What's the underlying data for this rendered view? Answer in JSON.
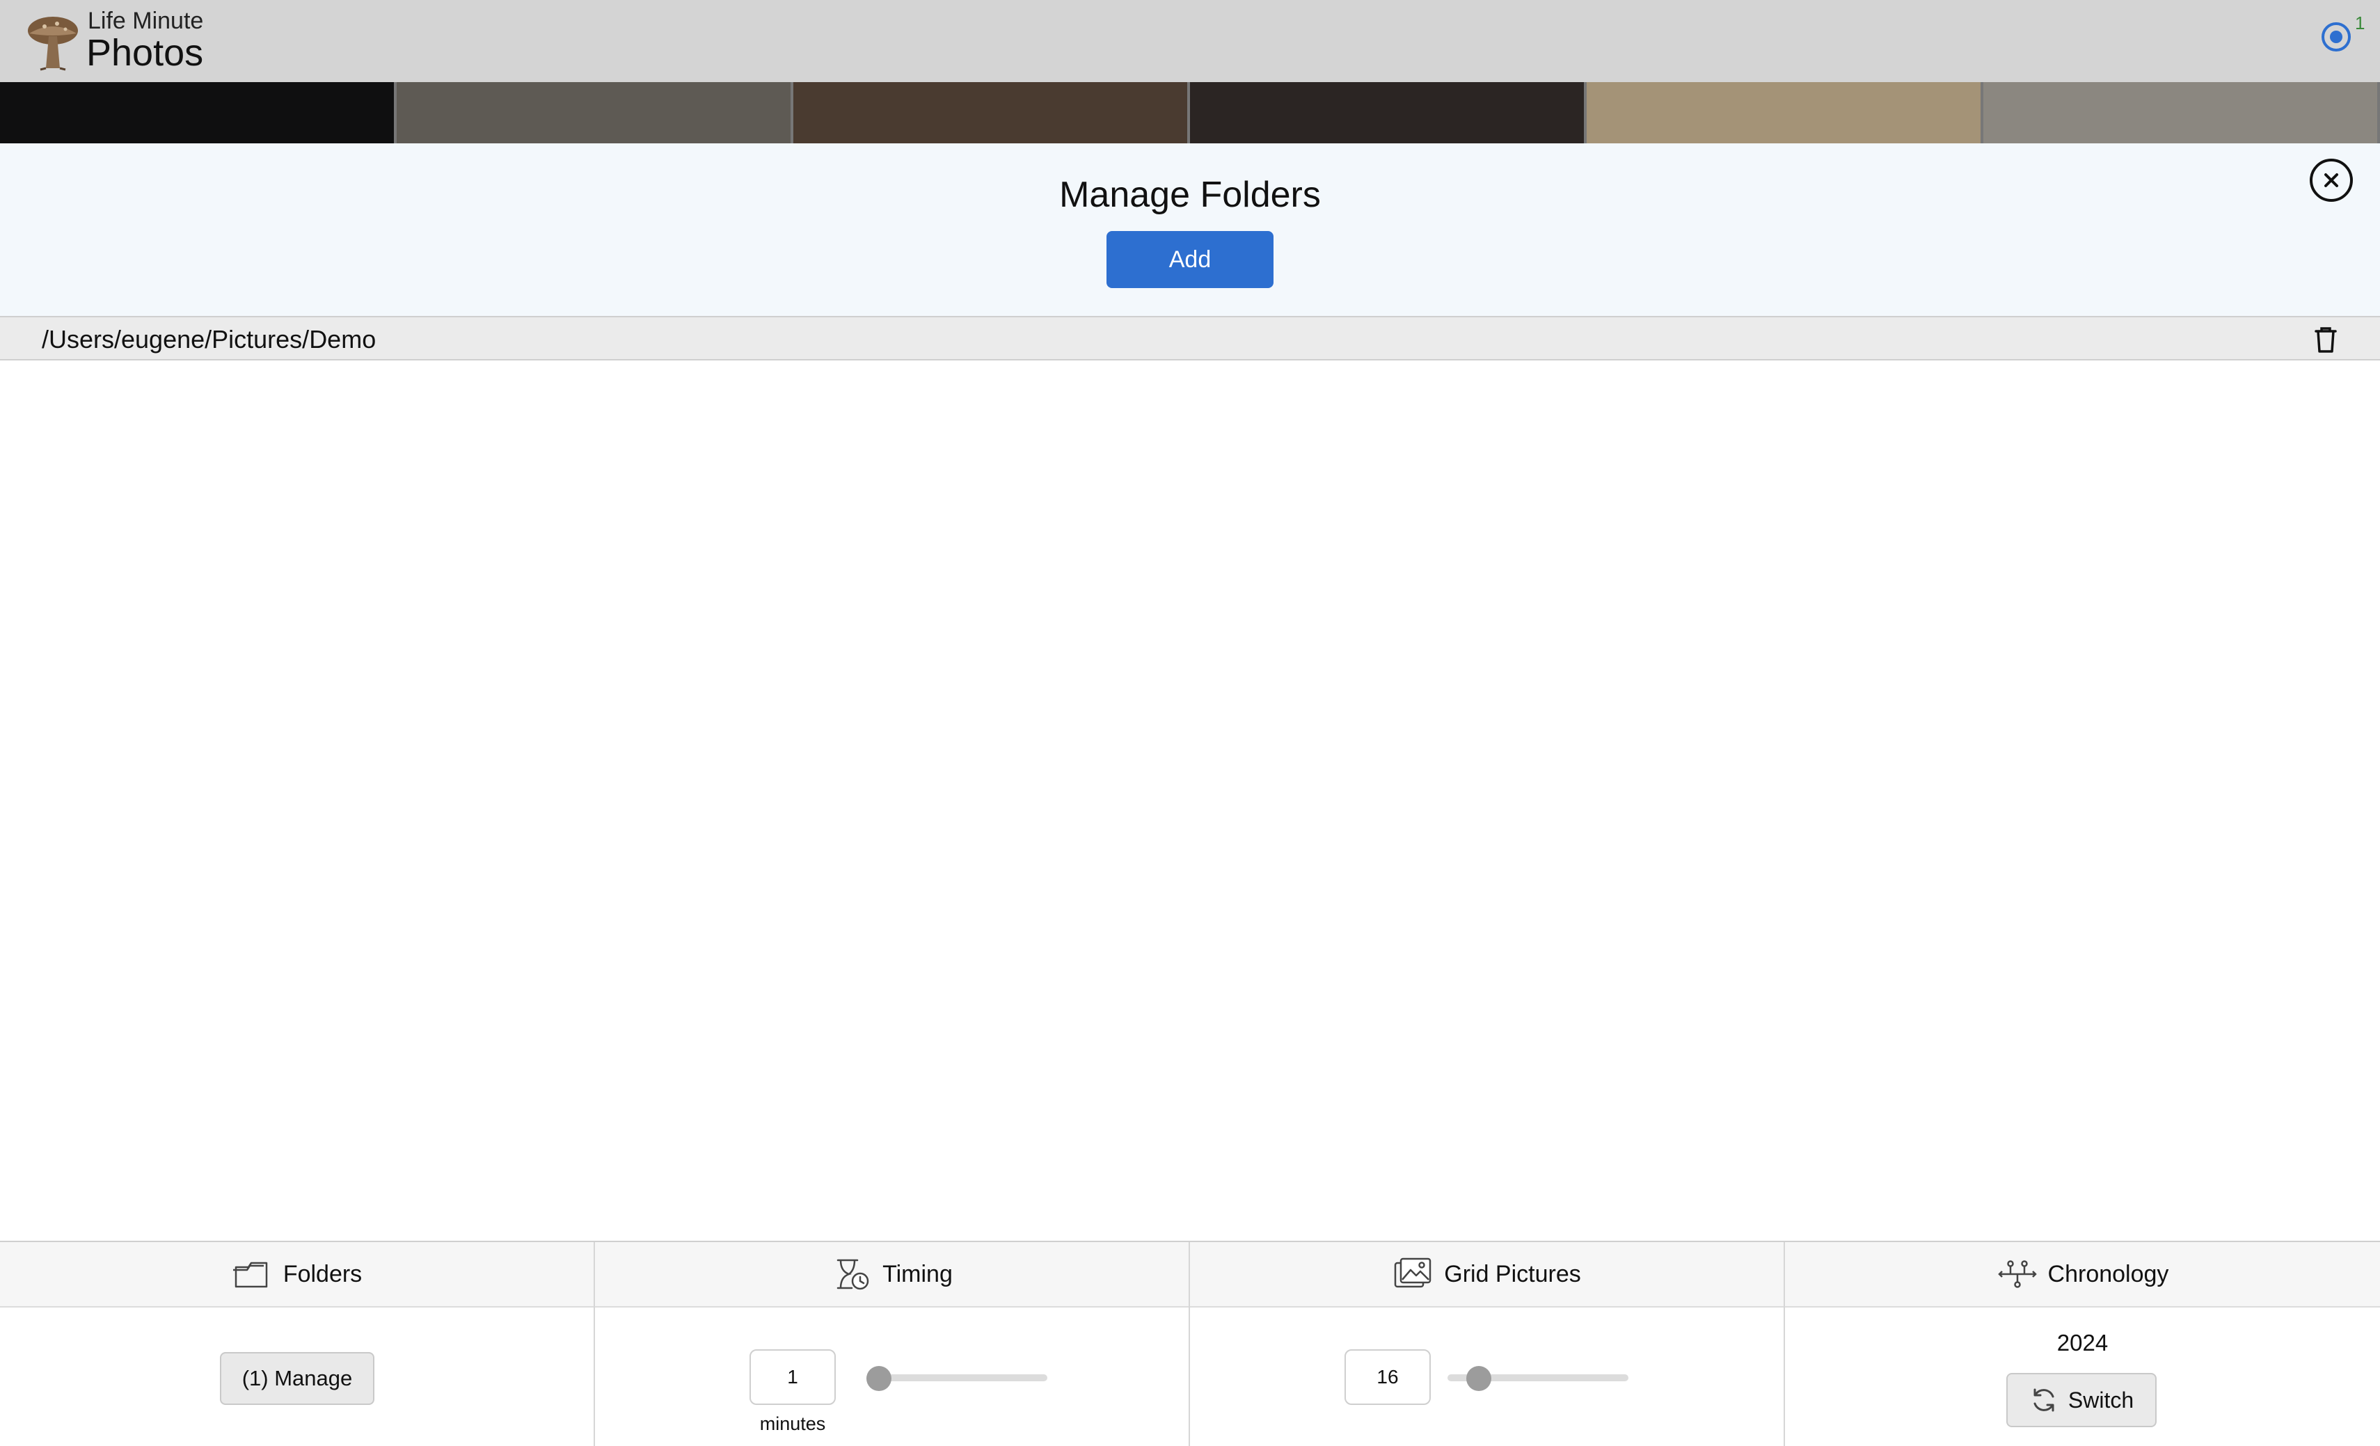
{
  "app": {
    "brand_small": "Life Minute",
    "brand_big": "Photos",
    "notification_count": "1"
  },
  "thumbnails": [
    {
      "name": "photo-lens-dark",
      "color": "#0f0f10"
    },
    {
      "name": "photo-street-winter",
      "color": "#5e5a54"
    },
    {
      "name": "photo-ceiling-room",
      "color": "#4a3b30"
    },
    {
      "name": "photo-dark-board",
      "color": "#2b2523"
    },
    {
      "name": "photo-floral-wall",
      "color": "#a49377"
    },
    {
      "name": "photo-kitchen-bottles",
      "color": "#8b8780"
    }
  ],
  "manage_folders": {
    "title": "Manage Folders",
    "add_label": "Add",
    "folders": [
      {
        "path": "/Users/eugene/Pictures/Demo"
      }
    ]
  },
  "bottom_controls": {
    "folders": {
      "title": "Folders",
      "manage_label": "(1) Manage"
    },
    "timing": {
      "title": "Timing",
      "value": "1",
      "unit": "minutes",
      "slider_fraction": 0.0
    },
    "grid_pictures": {
      "title": "Grid Pictures",
      "value": "16",
      "slider_fraction": 0.12
    },
    "chronology": {
      "title": "Chronology",
      "year": "2024",
      "switch_label": "Switch"
    }
  },
  "colors": {
    "accent": "#2d6fd0",
    "header_bg": "#d4d4d4",
    "panel_bg": "#f3f8fc",
    "notification": "#2d6fd0"
  }
}
